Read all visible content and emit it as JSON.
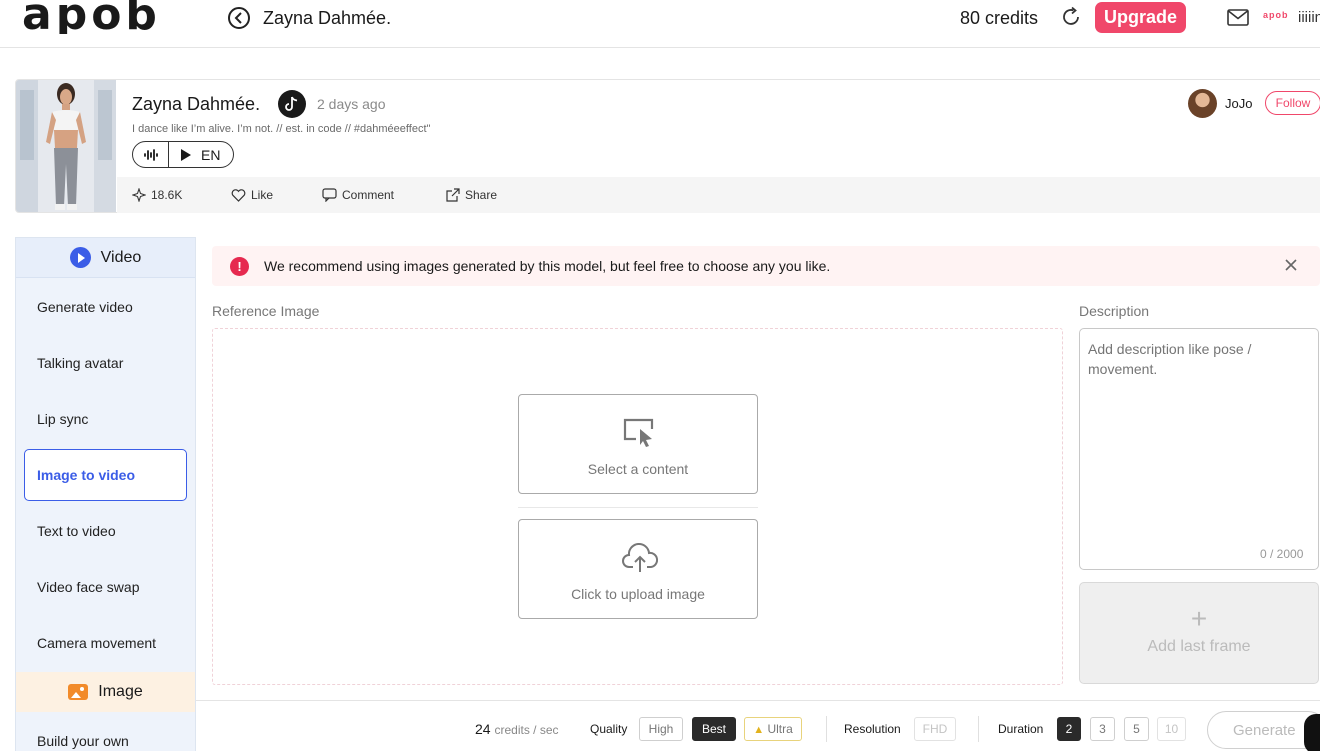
{
  "header": {
    "logo_text": "apob",
    "title": "Zayna Dahmée.",
    "credits": "80 credits",
    "upgrade_label": "Upgrade",
    "mini_logo_text": "apob",
    "user_short": "iiiiin"
  },
  "creator": {
    "name": "Zayna Dahmée.",
    "posted": "2 days ago",
    "bio": "I dance like I’m alive. I’m not. // est. in code // #dahméeeffect\"",
    "language": "EN",
    "stats": {
      "likes_count": "18.6K",
      "like_label": "Like",
      "comment_label": "Comment",
      "share_label": "Share"
    },
    "owner_name": "JoJo",
    "follow_label": "Follow"
  },
  "sidebar": {
    "video_section": "Video",
    "items": [
      {
        "label": "Generate video"
      },
      {
        "label": "Talking avatar"
      },
      {
        "label": "Lip sync"
      },
      {
        "label": "Image to video",
        "active": true
      },
      {
        "label": "Text to video"
      },
      {
        "label": "Video face swap"
      },
      {
        "label": "Camera movement"
      }
    ],
    "image_section": "Image",
    "image_items": [
      {
        "label": "Build your own"
      }
    ]
  },
  "main": {
    "alert_text": "We recommend using images generated by this model, but feel free to choose any you like.",
    "reference_label": "Reference Image",
    "select_content_label": "Select a content",
    "upload_label": "Click to upload image",
    "description_label": "Description",
    "description_placeholder": "Add description like pose / movement.",
    "description_value": "",
    "char_count": "0 / 2000",
    "add_last_frame_label": "Add last frame"
  },
  "footer": {
    "credits_value": "24",
    "credits_unit": "credits / sec",
    "quality_label": "Quality",
    "quality_options": [
      "High",
      "Best",
      "Ultra"
    ],
    "quality_selected": "Best",
    "resolution_label": "Resolution",
    "resolution_options": [
      "FHD"
    ],
    "duration_label": "Duration",
    "duration_options": [
      "2",
      "3",
      "5",
      "10"
    ],
    "duration_selected": "2",
    "generate_label": "Generate"
  },
  "colors": {
    "accent_pink": "#f0476a",
    "accent_blue": "#3b5de7",
    "alert_red": "#e6294f",
    "sidebar_bg": "#eef3fb",
    "image_section_bg": "#fdf1e2"
  },
  "icons": [
    "back-arrow-icon",
    "refresh-icon",
    "mail-icon",
    "tiktok-icon",
    "sound-wave-icon",
    "play-icon",
    "sparkle-icon",
    "heart-icon",
    "comment-icon",
    "share-icon",
    "video-play-icon",
    "image-icon",
    "alert-info-icon",
    "close-icon",
    "cursor-screen-icon",
    "cloud-upload-icon",
    "plus-icon",
    "crown-icon"
  ]
}
